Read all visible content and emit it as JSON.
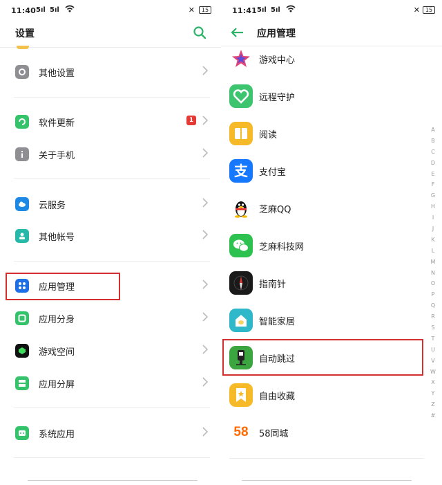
{
  "left": {
    "status": {
      "time": "11:40",
      "sig1": "5ıl",
      "sig2": "5ıl",
      "battery": "15"
    },
    "header": {
      "title": "设置"
    },
    "items": [
      {
        "label": "其他设置",
        "icon": "settings-icon"
      },
      {
        "label": "软件更新",
        "icon": "update-icon",
        "badge": "1"
      },
      {
        "label": "关于手机",
        "icon": "info-icon"
      },
      {
        "label": "云服务",
        "icon": "cloud-icon"
      },
      {
        "label": "其他帐号",
        "icon": "account-icon"
      },
      {
        "label": "应用管理",
        "icon": "app-grid-icon"
      },
      {
        "label": "应用分身",
        "icon": "clone-icon"
      },
      {
        "label": "游戏空间",
        "icon": "game-space-icon"
      },
      {
        "label": "应用分屏",
        "icon": "split-screen-icon"
      },
      {
        "label": "系统应用",
        "icon": "system-app-icon"
      }
    ]
  },
  "right": {
    "status": {
      "time": "11:41",
      "sig1": "5ıl",
      "sig2": "5ıl",
      "battery": "15"
    },
    "header": {
      "title": "应用管理"
    },
    "apps": [
      {
        "label": "游戏中心"
      },
      {
        "label": "远程守护"
      },
      {
        "label": "阅读"
      },
      {
        "label": "支付宝",
        "glyph": "支"
      },
      {
        "label": "芝麻QQ"
      },
      {
        "label": "芝麻科技网"
      },
      {
        "label": "指南针"
      },
      {
        "label": "智能家居"
      },
      {
        "label": "自动跳过"
      },
      {
        "label": "自由收藏"
      },
      {
        "label": "58同城",
        "glyph": "58"
      }
    ],
    "index": [
      "A",
      "B",
      "C",
      "D",
      "E",
      "F",
      "G",
      "H",
      "I",
      "J",
      "K",
      "L",
      "M",
      "N",
      "O",
      "P",
      "Q",
      "R",
      "S",
      "T",
      "U",
      "V",
      "W",
      "X",
      "Y",
      "Z",
      "#"
    ]
  }
}
